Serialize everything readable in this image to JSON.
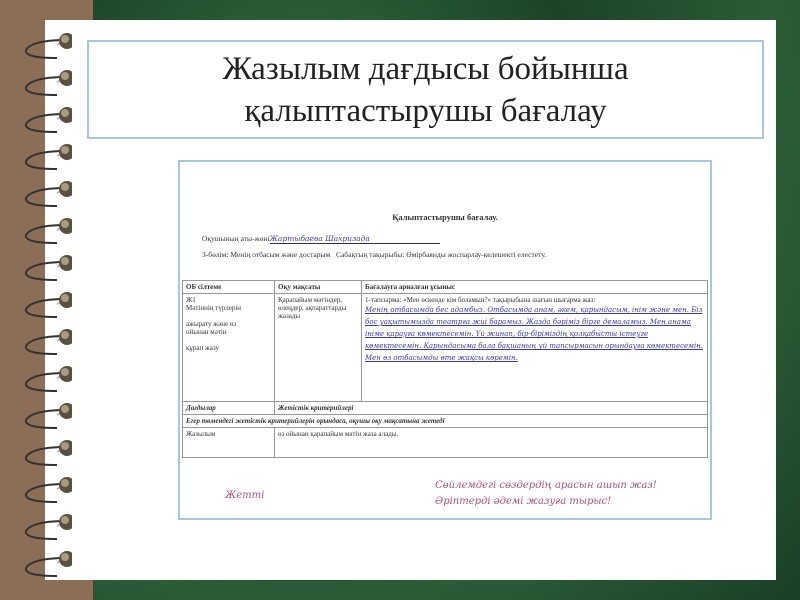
{
  "slide": {
    "title_line1": "Жазылым дағдысы бойынша",
    "title_line2": "қалыптастырушы бағалау"
  },
  "document": {
    "heading": "Қалыптастырушы бағалау.",
    "student_label": "Оқушының аты-жөні",
    "student_name": "Жартыбаева Шахризада",
    "section": "3-бөлім: Менің отбасым және достарым",
    "topic": "Сабақтың тақырыбы:  Өмірбаянды жоспарлау-келешекті елестету.",
    "col_headers": [
      "ОБ сілтеме",
      "Оқу мақсаты",
      "Бағалауға арналған ұсыныс"
    ],
    "ref": [
      "Ж1",
      "Мәтіннің түрлерін",
      "ажырату және өз",
      "ойынан мәтін",
      "құрап жазу"
    ],
    "objective": "Қарапайым мәтіндер, өлеңдер, ақпараттарды жазады",
    "task": "1-тапсырма:  «Мен өскенде кім боламын?» тақырыбына шағын шығарма жаз:",
    "handwriting": "Менің отбасымда бес адамбыз. Отбасымда анам, әкем, қарындасым, інім және мен. Біз бос уақытымызда театрға жиі барамыз. Жазда бәріміз бірге демаламыз. Мен анама ініме қарауға көмектесемін. Үй жинап, бір-біріміздің қолқабысты істеуге көмектесемін. Қарындасыма бала бақшаның үй тапсырмасын орындауға көмектесемін. Мен өз отбасымды өте жақсы көремін.",
    "skills_label": "Дағдылар",
    "criteria_label": "Жетістік критерийлері",
    "condition": "Егер төмендегі жетістік критерийлерін орындаса, оқушы оқу мақсатына жетеді",
    "skill": "Жазылым",
    "criterion": "өз ойынан қарапайым  мәтін жаза алады.",
    "mark": "Жетті",
    "comment1": "Сөйлемдегі сөздердің арасын ашып жаз!",
    "comment2": "Әріптерді әдемі жазуға тырыс!"
  }
}
